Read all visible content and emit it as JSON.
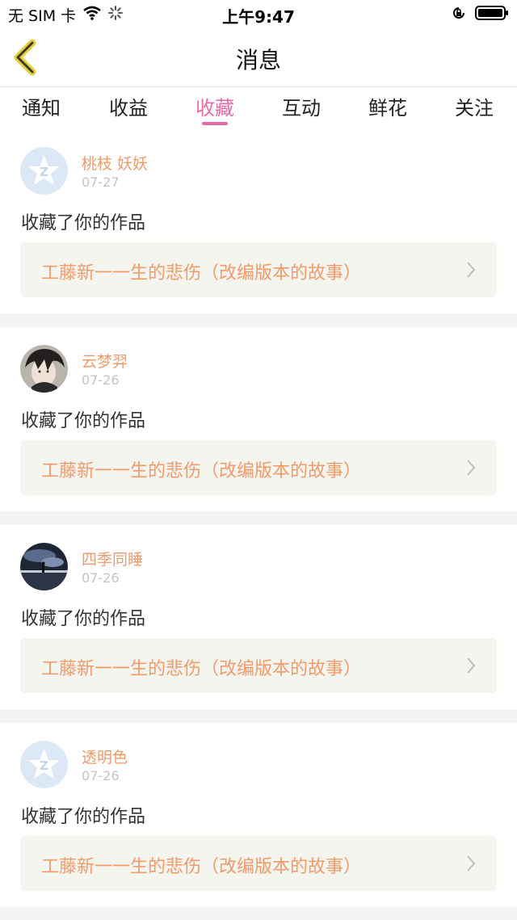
{
  "status": {
    "carrier": "无 SIM 卡",
    "time": "上午9:47",
    "icons": [
      "wifi-icon",
      "loading-icon",
      "rotation-lock-icon",
      "battery-icon"
    ]
  },
  "nav": {
    "title": "消息",
    "back_icon": "chevron-left-icon"
  },
  "tabs": [
    {
      "label": "通知",
      "active": false
    },
    {
      "label": "收益",
      "active": false
    },
    {
      "label": "收藏",
      "active": true
    },
    {
      "label": "互动",
      "active": false
    },
    {
      "label": "鲜花",
      "active": false
    },
    {
      "label": "关注",
      "active": false
    }
  ],
  "colors": {
    "accent_pink": "#e86aa8",
    "orange_text": "#f29a6a",
    "date_gray": "#c4c4c4"
  },
  "items": [
    {
      "user": "桃枝 妖妖",
      "date": "07-27",
      "action": "收藏了你的作品",
      "work": "工藤新一一生的悲伤（改编版本的故事）",
      "avatar": "default-avatar-icon"
    },
    {
      "user": "云梦羿",
      "date": "07-26",
      "action": "收藏了你的作品",
      "work": "工藤新一一生的悲伤（改编版本的故事）",
      "avatar": "anime-boy-avatar"
    },
    {
      "user": "四季同睡",
      "date": "07-26",
      "action": "收藏了你的作品",
      "work": "工藤新一一生的悲伤（改编版本的故事）",
      "avatar": "night-sky-avatar"
    },
    {
      "user": "透明色",
      "date": "07-26",
      "action": "收藏了你的作品",
      "work": "工藤新一一生的悲伤（改编版本的故事）",
      "avatar": "default-avatar-icon"
    }
  ]
}
